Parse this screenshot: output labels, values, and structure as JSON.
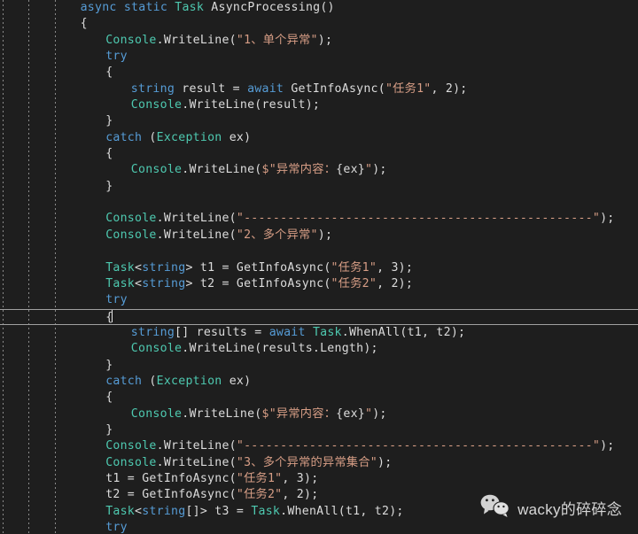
{
  "editor": {
    "theme": "dark",
    "background_color": "#1e1e1e",
    "language": "csharp",
    "colors": {
      "keyword": "#569cd6",
      "type": "#4ec9b0",
      "string": "#d69d85",
      "plain": "#dcdcdc",
      "indent_guide": "#8a8a8a",
      "current_line_border": "#a0a0a0"
    },
    "indent_guide_x_positions": [
      3,
      32,
      62
    ],
    "current_line_index": 19,
    "lines": [
      {
        "indent": 1,
        "tokens": [
          {
            "t": "async ",
            "c": "kw"
          },
          {
            "t": "static ",
            "c": "kw"
          },
          {
            "t": "Task",
            "c": "typ"
          },
          {
            "t": " AsyncProcessing()",
            "c": "plain"
          }
        ]
      },
      {
        "indent": 1,
        "tokens": [
          {
            "t": "{",
            "c": "plain"
          }
        ]
      },
      {
        "indent": 2,
        "tokens": [
          {
            "t": "Console",
            "c": "typ"
          },
          {
            "t": ".WriteLine(",
            "c": "plain"
          },
          {
            "t": "\"1、单个异常\"",
            "c": "str"
          },
          {
            "t": ");",
            "c": "plain"
          }
        ]
      },
      {
        "indent": 2,
        "tokens": [
          {
            "t": "try",
            "c": "kw"
          }
        ]
      },
      {
        "indent": 2,
        "tokens": [
          {
            "t": "{",
            "c": "plain"
          }
        ]
      },
      {
        "indent": 3,
        "tokens": [
          {
            "t": "string",
            "c": "kw"
          },
          {
            "t": " result = ",
            "c": "plain"
          },
          {
            "t": "await",
            "c": "kw"
          },
          {
            "t": " GetInfoAsync(",
            "c": "plain"
          },
          {
            "t": "\"任务1\"",
            "c": "str"
          },
          {
            "t": ", 2);",
            "c": "plain"
          }
        ]
      },
      {
        "indent": 3,
        "tokens": [
          {
            "t": "Console",
            "c": "typ"
          },
          {
            "t": ".WriteLine(result);",
            "c": "plain"
          }
        ]
      },
      {
        "indent": 2,
        "tokens": [
          {
            "t": "}",
            "c": "plain"
          }
        ]
      },
      {
        "indent": 2,
        "tokens": [
          {
            "t": "catch",
            "c": "kw"
          },
          {
            "t": " (",
            "c": "plain"
          },
          {
            "t": "Exception",
            "c": "typ"
          },
          {
            "t": " ex)",
            "c": "plain"
          }
        ]
      },
      {
        "indent": 2,
        "tokens": [
          {
            "t": "{",
            "c": "plain"
          }
        ]
      },
      {
        "indent": 3,
        "tokens": [
          {
            "t": "Console",
            "c": "typ"
          },
          {
            "t": ".WriteLine(",
            "c": "plain"
          },
          {
            "t": "$\"异常内容：",
            "c": "str"
          },
          {
            "t": "{ex}",
            "c": "plain"
          },
          {
            "t": "\"",
            "c": "str"
          },
          {
            "t": ");",
            "c": "plain"
          }
        ]
      },
      {
        "indent": 2,
        "tokens": [
          {
            "t": "}",
            "c": "plain"
          }
        ]
      },
      {
        "indent": 0,
        "tokens": []
      },
      {
        "indent": 2,
        "tokens": [
          {
            "t": "Console",
            "c": "typ"
          },
          {
            "t": ".WriteLine(",
            "c": "plain"
          },
          {
            "t": "\"------------------------------------------------\"",
            "c": "str"
          },
          {
            "t": ");",
            "c": "plain"
          }
        ]
      },
      {
        "indent": 2,
        "tokens": [
          {
            "t": "Console",
            "c": "typ"
          },
          {
            "t": ".WriteLine(",
            "c": "plain"
          },
          {
            "t": "\"2、多个异常\"",
            "c": "str"
          },
          {
            "t": ");",
            "c": "plain"
          }
        ]
      },
      {
        "indent": 0,
        "tokens": []
      },
      {
        "indent": 2,
        "tokens": [
          {
            "t": "Task",
            "c": "typ"
          },
          {
            "t": "<",
            "c": "plain"
          },
          {
            "t": "string",
            "c": "kw"
          },
          {
            "t": "> t1 = GetInfoAsync(",
            "c": "plain"
          },
          {
            "t": "\"任务1\"",
            "c": "str"
          },
          {
            "t": ", 3);",
            "c": "plain"
          }
        ]
      },
      {
        "indent": 2,
        "tokens": [
          {
            "t": "Task",
            "c": "typ"
          },
          {
            "t": "<",
            "c": "plain"
          },
          {
            "t": "string",
            "c": "kw"
          },
          {
            "t": "> t2 = GetInfoAsync(",
            "c": "plain"
          },
          {
            "t": "\"任务2\"",
            "c": "str"
          },
          {
            "t": ", 2);",
            "c": "plain"
          }
        ]
      },
      {
        "indent": 2,
        "tokens": [
          {
            "t": "try",
            "c": "kw"
          }
        ]
      },
      {
        "indent": 2,
        "tokens": [
          {
            "t": "{",
            "c": "plain"
          }
        ],
        "current": true
      },
      {
        "indent": 3,
        "tokens": [
          {
            "t": "string",
            "c": "kw"
          },
          {
            "t": "[] results = ",
            "c": "plain"
          },
          {
            "t": "await",
            "c": "kw"
          },
          {
            "t": " ",
            "c": "plain"
          },
          {
            "t": "Task",
            "c": "typ"
          },
          {
            "t": ".WhenAll(t1, t2);",
            "c": "plain"
          }
        ]
      },
      {
        "indent": 3,
        "tokens": [
          {
            "t": "Console",
            "c": "typ"
          },
          {
            "t": ".WriteLine(results.Length);",
            "c": "plain"
          }
        ]
      },
      {
        "indent": 2,
        "tokens": [
          {
            "t": "}",
            "c": "plain"
          }
        ]
      },
      {
        "indent": 2,
        "tokens": [
          {
            "t": "catch",
            "c": "kw"
          },
          {
            "t": " (",
            "c": "plain"
          },
          {
            "t": "Exception",
            "c": "typ"
          },
          {
            "t": " ex)",
            "c": "plain"
          }
        ]
      },
      {
        "indent": 2,
        "tokens": [
          {
            "t": "{",
            "c": "plain"
          }
        ]
      },
      {
        "indent": 3,
        "tokens": [
          {
            "t": "Console",
            "c": "typ"
          },
          {
            "t": ".WriteLine(",
            "c": "plain"
          },
          {
            "t": "$\"异常内容：",
            "c": "str"
          },
          {
            "t": "{ex}",
            "c": "plain"
          },
          {
            "t": "\"",
            "c": "str"
          },
          {
            "t": ");",
            "c": "plain"
          }
        ]
      },
      {
        "indent": 2,
        "tokens": [
          {
            "t": "}",
            "c": "plain"
          }
        ]
      },
      {
        "indent": 2,
        "tokens": [
          {
            "t": "Console",
            "c": "typ"
          },
          {
            "t": ".WriteLine(",
            "c": "plain"
          },
          {
            "t": "\"------------------------------------------------\"",
            "c": "str"
          },
          {
            "t": ");",
            "c": "plain"
          }
        ]
      },
      {
        "indent": 2,
        "tokens": [
          {
            "t": "Console",
            "c": "typ"
          },
          {
            "t": ".WriteLine(",
            "c": "plain"
          },
          {
            "t": "\"3、多个异常的异常集合\"",
            "c": "str"
          },
          {
            "t": ");",
            "c": "plain"
          }
        ]
      },
      {
        "indent": 2,
        "tokens": [
          {
            "t": "t1 = GetInfoAsync(",
            "c": "plain"
          },
          {
            "t": "\"任务1\"",
            "c": "str"
          },
          {
            "t": ", 3);",
            "c": "plain"
          }
        ]
      },
      {
        "indent": 2,
        "tokens": [
          {
            "t": "t2 = GetInfoAsync(",
            "c": "plain"
          },
          {
            "t": "\"任务2\"",
            "c": "str"
          },
          {
            "t": ", 2);",
            "c": "plain"
          }
        ]
      },
      {
        "indent": 2,
        "tokens": [
          {
            "t": "Task",
            "c": "typ"
          },
          {
            "t": "<",
            "c": "plain"
          },
          {
            "t": "string",
            "c": "kw"
          },
          {
            "t": "[]> t3 = ",
            "c": "plain"
          },
          {
            "t": "Task",
            "c": "typ"
          },
          {
            "t": ".WhenAll(t1, t2);",
            "c": "plain"
          }
        ]
      },
      {
        "indent": 2,
        "tokens": [
          {
            "t": "try",
            "c": "kw"
          }
        ]
      }
    ]
  },
  "watermark": {
    "icon": "wechat-icon",
    "text": "wacky的碎碎念",
    "color": "#e6e6e6"
  }
}
